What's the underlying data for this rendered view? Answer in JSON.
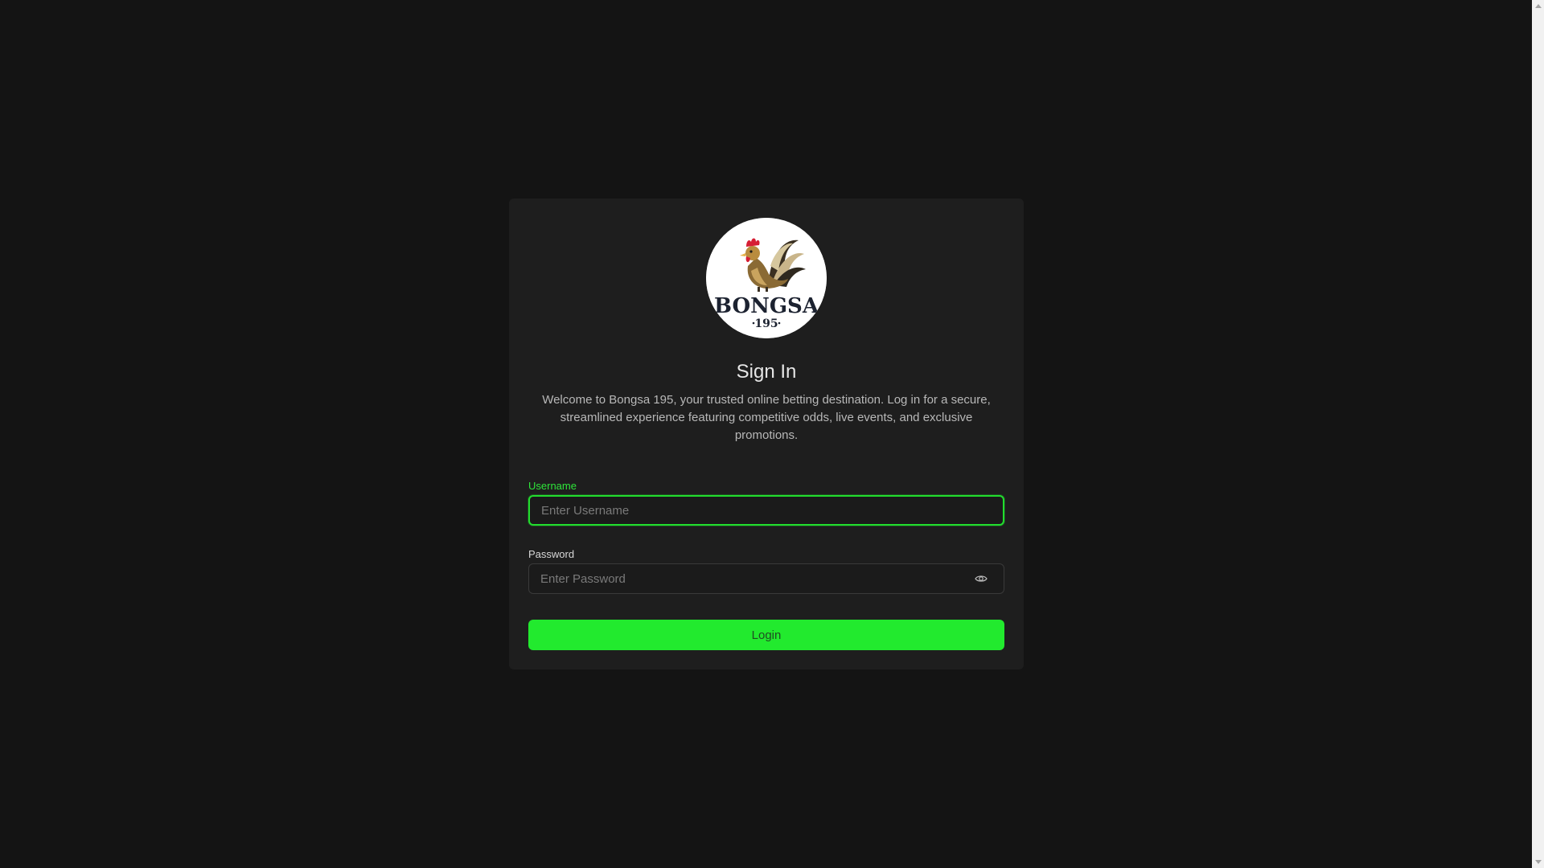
{
  "brand": {
    "logo_text": "BONGSA",
    "logo_number": "195",
    "logo_icon": "rooster-icon"
  },
  "signin": {
    "title": "Sign In",
    "description": "Welcome to Bongsa 195, your trusted online betting destination. Log in for a secure, streamlined experience featuring competitive odds, live events, and exclusive promotions."
  },
  "form": {
    "username": {
      "label": "Username",
      "placeholder": "Enter Username",
      "value": ""
    },
    "password": {
      "label": "Password",
      "placeholder": "Enter Password",
      "value": "",
      "toggle_icon": "eye-icon"
    },
    "login_label": "Login"
  },
  "colors": {
    "background": "#141414",
    "card": "#1e1e1e",
    "accent": "#22ea2e",
    "focus_border": "#22dd2e"
  }
}
